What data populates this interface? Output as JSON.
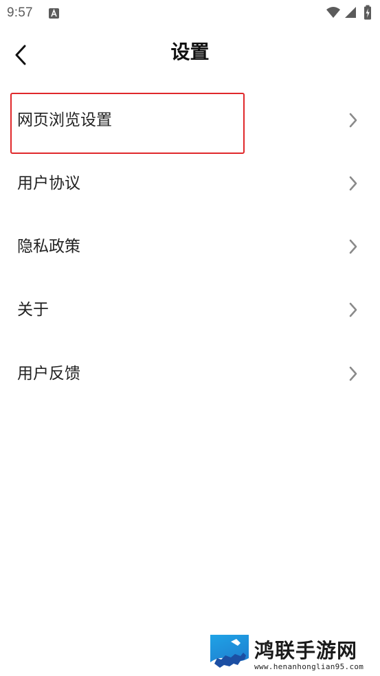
{
  "status_bar": {
    "time": "9:57",
    "notification_icon": "a-icon",
    "wifi_icon": "wifi-icon",
    "signal_icon": "signal-icon",
    "battery_icon": "battery-charging-icon"
  },
  "header": {
    "back_icon": "chevron-left-icon",
    "title": "设置"
  },
  "menu": {
    "items": [
      {
        "label": "网页浏览设置",
        "highlighted": true
      },
      {
        "label": "用户协议"
      },
      {
        "label": "隐私政策"
      },
      {
        "label": "关于"
      },
      {
        "label": "用户反馈"
      }
    ],
    "chevron_icon": "chevron-right-icon"
  },
  "colors": {
    "highlight_border": "#e0272a",
    "chevron": "#8a8a8a",
    "watermark_blue": "#1f8fd8"
  },
  "watermark": {
    "name": "鸿联手游网",
    "url": "www.henanhonglian95.com"
  }
}
